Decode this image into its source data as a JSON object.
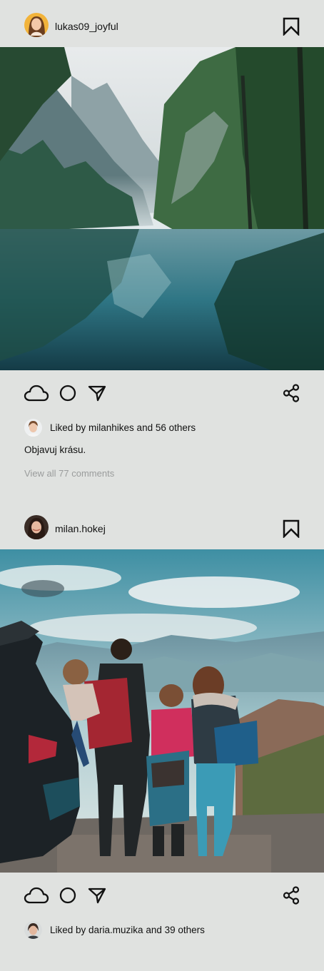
{
  "posts": [
    {
      "username": "lukas09_joyful",
      "likes_text": "Liked by milanhikes and 56 others",
      "caption": "Objavuj krásu.",
      "view_comments": "View all 77 comments",
      "photo_subject": "misty mountain lake with forest reflections"
    },
    {
      "username": "milan.hokej",
      "likes_text": "Liked by daria.muzika and 39 others",
      "photo_subject": "family with backpacks overlooking valley beside a car"
    }
  ],
  "icons": {
    "bookmark": "bookmark-icon",
    "like": "cloud-icon",
    "comment": "comment-circle-icon",
    "send": "send-icon",
    "share": "share-icon"
  },
  "colors": {
    "background": "#e0e2e0",
    "text": "#111111",
    "muted": "#9a9c9c"
  }
}
